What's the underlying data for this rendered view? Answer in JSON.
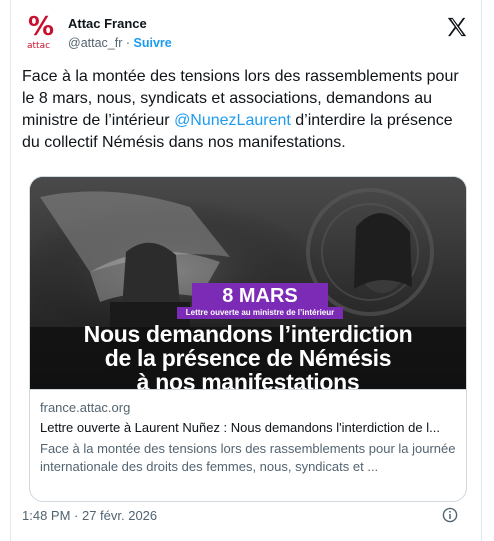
{
  "author": {
    "avatar_symbol": "%",
    "avatar_brand": "attac",
    "name": "Attac France",
    "handle": "@attac_fr",
    "separator": "·",
    "follow_label": "Suivre"
  },
  "tweet": {
    "text_part1": "Face à la montée des tensions lors des rassemblements pour le 8 mars, nous, syndicats et associations, demandons au ministre de l’intérieur ",
    "mention": "@NunezLaurent",
    "text_part2": " d’interdire la présence du collectif Némésis dans nos manifestations."
  },
  "media": {
    "badge_date": "8 MARS",
    "badge_sub": "Lettre ouverte au ministre de l’intérieur",
    "headline_line1": "Nous demandons l’interdiction",
    "headline_line2": "de la présence de Némésis",
    "headline_line3": "à nos manifestations"
  },
  "link_card": {
    "domain": "france.attac.org",
    "title": "Lettre ouverte à Laurent Nuñez : Nous demandons l'interdiction de l...",
    "description": "Face à la montée des tensions lors des rassemblements pour la journée internationale des droits des femmes, nous, syndicats et ..."
  },
  "footer": {
    "timestamp": "1:48 PM · 27 févr. 2026"
  },
  "colors": {
    "accent": "#1d9bf0",
    "brand": "#c8102e",
    "badge": "#7b2bb5"
  },
  "icons": [
    "x-logo-icon",
    "info-icon"
  ]
}
